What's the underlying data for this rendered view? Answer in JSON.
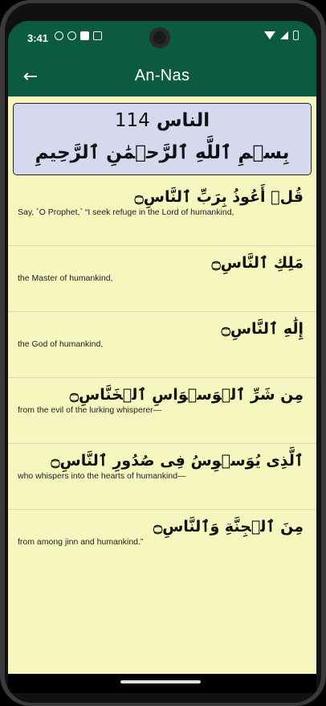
{
  "status": {
    "time": "3:41"
  },
  "appbar": {
    "title": "An-Nas",
    "back_icon": "arrow-left-icon"
  },
  "header": {
    "surah_name_ar": "الناس",
    "surah_number": "114",
    "bismillah": "بِسۡمِ ٱللَّهِ ٱلرَّحۡمَٰنِ ٱلرَّحِيمِ"
  },
  "verses": [
    {
      "ar": "قُلۡ أَعُوذُ بِرَبِّ ٱلنَّاسِ۝",
      "en": "Say, ˹O Prophet,˺ “I seek refuge in the Lord of humankind,"
    },
    {
      "ar": "مَلِكِ ٱلنَّاسِ۝",
      "en": "the Master of humankind,"
    },
    {
      "ar": "إِلَٰهِ ٱلنَّاسِ۝",
      "en": "the God of humankind,"
    },
    {
      "ar": "مِن شَرِّ ٱلۡوَسۡوَاسِ ٱلۡخَنَّاسِ۝",
      "en": "from the evil of the lurking whisperer—"
    },
    {
      "ar": "ٱلَّذِى يُوَسۡوِسُ فِى صُدُورِ ٱلنَّاسِ۝",
      "en": "who whispers into the hearts of humankind—"
    },
    {
      "ar": "مِنَ ٱلۡجِنَّةِ وَٱلنَّاسِ۝",
      "en": "from among jinn and humankind.”"
    }
  ]
}
